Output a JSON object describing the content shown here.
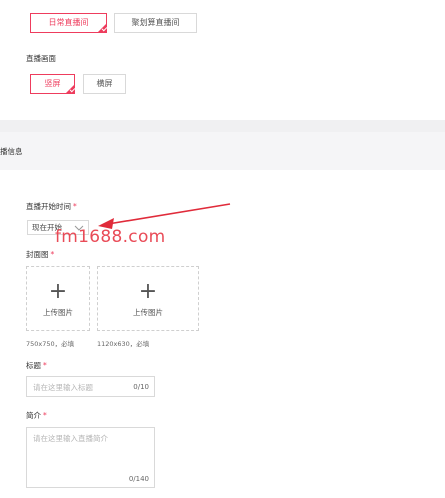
{
  "live_type": {
    "options": [
      "日常直播间",
      "聚划算直播间"
    ],
    "selected_index": 0
  },
  "live_screen": {
    "label": "直播画面",
    "options": [
      "竖屏",
      "横屏"
    ],
    "selected_index": 0
  },
  "section": {
    "title": "播信息"
  },
  "start_time": {
    "label": "直播开始时间",
    "required_mark": "*",
    "value": "现在开始"
  },
  "cover": {
    "label": "封面图",
    "required_mark": "*",
    "uploads": [
      {
        "button_label": "上传图片",
        "hint": "750x750，必填"
      },
      {
        "button_label": "上传图片",
        "hint": "1120x630，必填"
      }
    ],
    "plus_glyph": "+"
  },
  "title_field": {
    "label": "标题",
    "required_mark": "*",
    "placeholder": "请在这里输入标题",
    "counter": "0/10"
  },
  "intro_field": {
    "label": "简介",
    "required_mark": "*",
    "placeholder": "请在这里输入直播简介",
    "counter": "0/140"
  },
  "watermark": "fm1688.com",
  "colors": {
    "accent": "#ee3c5d",
    "arrow": "#e02b3a",
    "band": "#f0f0f2",
    "border": "#d9d9d9"
  }
}
